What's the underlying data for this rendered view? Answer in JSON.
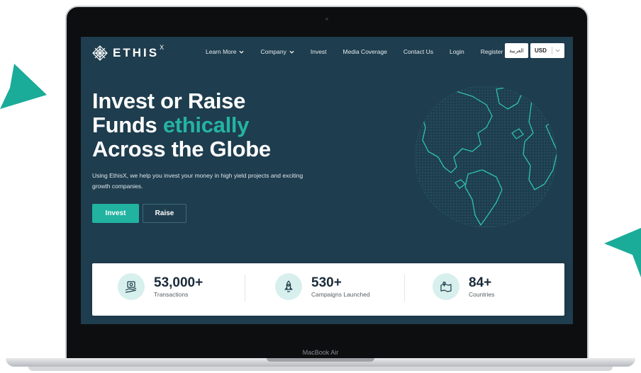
{
  "brand": {
    "name": "ETHIS",
    "sup": "X"
  },
  "nav": [
    {
      "label": "Learn More",
      "dropdown": true
    },
    {
      "label": "Company",
      "dropdown": true
    },
    {
      "label": "Invest",
      "dropdown": false
    },
    {
      "label": "Media Coverage",
      "dropdown": false
    },
    {
      "label": "Contact Us",
      "dropdown": false
    },
    {
      "label": "Login",
      "dropdown": false
    },
    {
      "label": "Register",
      "dropdown": false
    }
  ],
  "language_label": "العربية",
  "currency": {
    "selected": "USD"
  },
  "hero": {
    "line1": "Invest or Raise",
    "line2_prefix": "Funds ",
    "line2_accent": "ethically",
    "line3": "Across the Globe",
    "subtitle": "Using EthisX, we help you invest your money in high yield projects and exciting growth companies.",
    "invest_label": "Invest",
    "raise_label": "Raise"
  },
  "stats": [
    {
      "value": "53,000+",
      "label": "Transactions",
      "icon": "money-hand-icon"
    },
    {
      "value": "530+",
      "label": "Campaigns Launched",
      "icon": "rocket-icon"
    },
    {
      "value": "84+",
      "label": "Countries",
      "icon": "map-pin-icon"
    }
  ],
  "device_label": "MacBook Air",
  "colors": {
    "background": "#1e3d4e",
    "accent": "#25b3a3",
    "button": "#21b3a0",
    "icon_bg": "#d8f0ed",
    "decor": "#1aab99"
  }
}
